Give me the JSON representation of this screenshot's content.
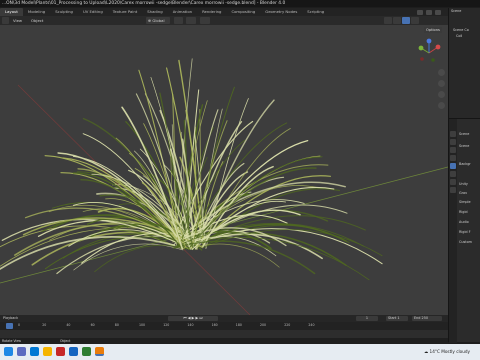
{
  "window": {
    "title": "...ON\\3d Model\\Plants\\01_Processing to Upload\\L2020\\Carex morrowii -sedge\\Blender\\Carex morrowii -sedge.blend] - Blender 4.0"
  },
  "workspace_tabs": [
    "Layout",
    "Modeling",
    "Sculpting",
    "UV Editing",
    "Texture Paint",
    "Shading",
    "Animation",
    "Rendering",
    "Compositing",
    "Geometry Nodes",
    "Scripting"
  ],
  "header": {
    "view_label": "View",
    "object_label": "Object",
    "transform_orientation": "Global",
    "options_label": "Options"
  },
  "outliner": {
    "title": "Scene",
    "rows": [
      "Scene Co",
      "Coll"
    ]
  },
  "properties": {
    "title": "Scene",
    "rows": [
      "Scene",
      "Backgr",
      "Unity",
      "Grav",
      "Simple",
      "Rigid",
      "Audio",
      "Rigid F",
      "Custom"
    ]
  },
  "timeline": {
    "playback_label": "Playback",
    "current_frame": "1",
    "start_label": "Start",
    "start_value": "1",
    "end_label": "End",
    "end_value": "250",
    "ticks": [
      "0",
      "20",
      "40",
      "60",
      "80",
      "100",
      "120",
      "140",
      "160",
      "180",
      "200",
      "220",
      "240"
    ]
  },
  "statusbar": {
    "left": "Rotate View",
    "right": "Object"
  },
  "taskbar": {
    "weather_temp": "14°C",
    "weather_text": "Mostly cloudy"
  },
  "colors": {
    "viewport_bg": "#3d3d3d",
    "blade_light": "#d7dba8",
    "blade_mid": "#a8b25a",
    "blade_dark": "#4f6820",
    "active_accent": "#4772b3"
  }
}
